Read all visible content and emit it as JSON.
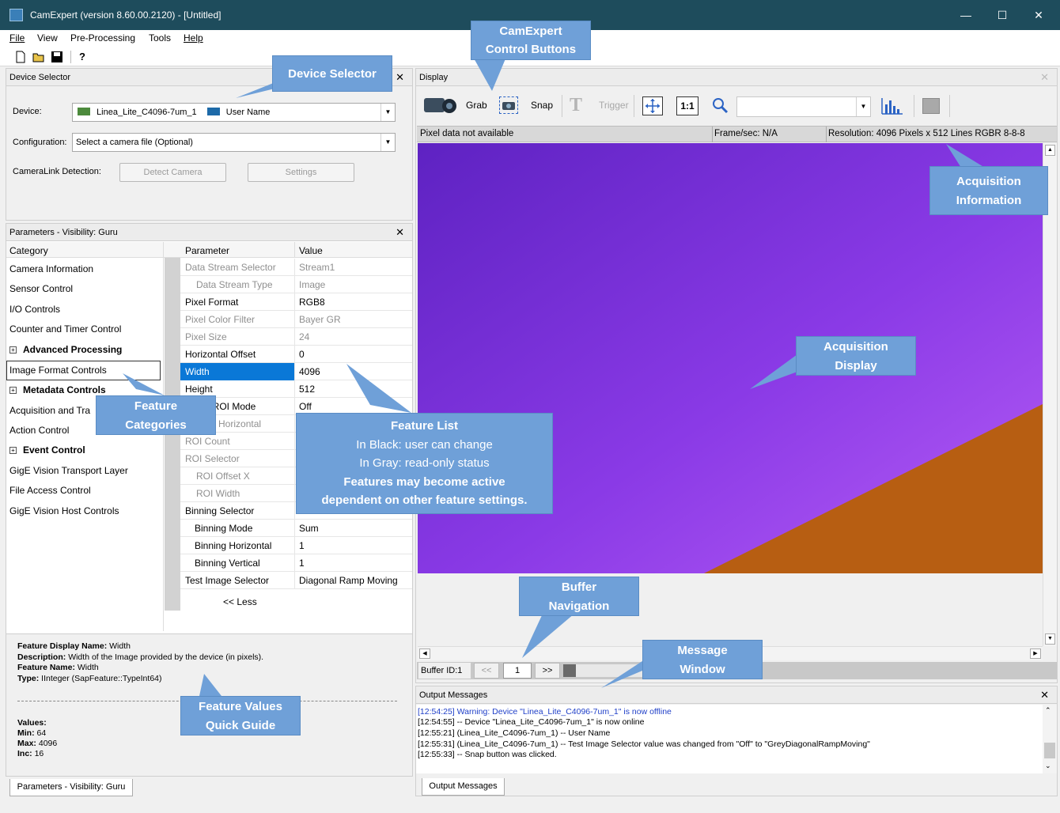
{
  "window": {
    "title": "CamExpert (version 8.60.00.2120) - [Untitled]",
    "controls": [
      "—",
      "☐",
      "✕"
    ]
  },
  "menu": [
    "File",
    "View",
    "Pre-Processing",
    "Tools",
    "Help"
  ],
  "toolbar_icons": [
    "new-file-icon",
    "open-folder-icon",
    "save-icon",
    "help-icon"
  ],
  "device_selector": {
    "title": "Device Selector",
    "device_label": "Device:",
    "device_value": "Linea_Lite_C4096-7um_1",
    "user_name": "User Name",
    "configuration_label": "Configuration:",
    "configuration_value": "Select a camera file (Optional)",
    "cameralink_label": "CameraLink Detection:",
    "detect_button": "Detect Camera",
    "settings_button": "Settings"
  },
  "parameters": {
    "title": "Parameters - Visibility: Guru",
    "category_header": "Category",
    "parameter_header": "Parameter",
    "value_header": "Value",
    "categories": [
      {
        "label": "Camera Information",
        "bold": false,
        "expandable": false
      },
      {
        "label": "Sensor Control",
        "bold": false,
        "expandable": false
      },
      {
        "label": "I/O Controls",
        "bold": false,
        "expandable": false
      },
      {
        "label": "Counter and Timer Control",
        "bold": false,
        "expandable": false
      },
      {
        "label": "Advanced Processing",
        "bold": true,
        "expandable": true
      },
      {
        "label": "Image Format Controls",
        "bold": false,
        "expandable": false,
        "selected": true
      },
      {
        "label": "Metadata Controls",
        "bold": true,
        "expandable": true
      },
      {
        "label": "Acquisition and Tra",
        "bold": false,
        "expandable": false
      },
      {
        "label": "Action Control",
        "bold": false,
        "expandable": false
      },
      {
        "label": "Event Control",
        "bold": true,
        "expandable": true
      },
      {
        "label": "GigE Vision Transport Layer",
        "bold": false,
        "expandable": false
      },
      {
        "label": "File Access Control",
        "bold": false,
        "expandable": false
      },
      {
        "label": "GigE Vision Host Controls",
        "bold": false,
        "expandable": false
      }
    ],
    "rows": [
      {
        "name": "Data Stream Selector",
        "value": "Stream1",
        "readonly": true
      },
      {
        "name": "  Data Stream Type",
        "value": "Image",
        "readonly": true
      },
      {
        "name": "Pixel Format",
        "value": "RGB8",
        "readonly": false
      },
      {
        "name": "Pixel Color Filter",
        "value": "Bayer GR",
        "readonly": true
      },
      {
        "name": "Pixel Size",
        "value": "24",
        "readonly": true
      },
      {
        "name": "Horizontal Offset",
        "value": "0",
        "readonly": false
      },
      {
        "name": "Width",
        "value": "4096",
        "readonly": false,
        "selected": true
      },
      {
        "name": "Height",
        "value": "512",
        "readonly": false
      },
      {
        "name": "le ROI Mode",
        "value": "Off",
        "readonly": false
      },
      {
        "name": "unt Horizontal",
        "value": "",
        "readonly": true
      },
      {
        "name": "ROI Count",
        "value": "",
        "readonly": true
      },
      {
        "name": "ROI Selector",
        "value": "",
        "readonly": true
      },
      {
        "name": "  ROI Offset X",
        "value": "",
        "readonly": true
      },
      {
        "name": "  ROI Width",
        "value": "",
        "readonly": true
      },
      {
        "name": "Binning Selector",
        "value": "",
        "readonly": false
      },
      {
        "name": "  Binning Mode",
        "value": "Sum",
        "readonly": false
      },
      {
        "name": "  Binning Horizontal",
        "value": "1",
        "readonly": false
      },
      {
        "name": "  Binning Vertical",
        "value": "1",
        "readonly": false
      },
      {
        "name": "Test Image Selector",
        "value": "Diagonal Ramp Moving",
        "readonly": false
      }
    ],
    "less_link": "<< Less",
    "bottom_tab": "Parameters - Visibility: Guru"
  },
  "feature_info": {
    "display_name_label": "Feature Display Name:",
    "display_name": "Width",
    "description_label": "Description:",
    "description": "Width of the Image provided by the device (in pixels).",
    "feature_name_label": "Feature Name:",
    "feature_name": "Width",
    "type_label": "Type:",
    "type": "IInteger (SapFeature::TypeInt64)",
    "values_label": "Values:",
    "min_label": "Min:",
    "min": "64",
    "max_label": "Max:",
    "max": "4096",
    "inc_label": "Inc:",
    "inc": "16"
  },
  "display": {
    "title": "Display",
    "grab": "Grab",
    "snap": "Snap",
    "trigger": "Trigger",
    "one_to_one": "1:1",
    "status_pixel": "Pixel data not available",
    "status_fps": "Frame/sec: N/A",
    "status_resolution": "Resolution: 4096 Pixels x 512 Lines  RGBR 8-8-8",
    "buffer_id": "Buffer ID:1",
    "buffer_prev": "<<",
    "buffer_value": "1",
    "buffer_next": ">>"
  },
  "output": {
    "title": "Output Messages",
    "tab": "Output Messages",
    "messages": [
      {
        "text": "[12:54:25] Warning: Device \"Linea_Lite_C4096-7um_1\" is now offline",
        "color": "#1f3fc8"
      },
      {
        "text": "[12:54:55] -- Device \"Linea_Lite_C4096-7um_1\" is now online",
        "color": "#000000"
      },
      {
        "text": "[12:55:21] (Linea_Lite_C4096-7um_1)  -- User Name",
        "color": "#000000"
      },
      {
        "text": "[12:55:31] (Linea_Lite_C4096-7um_1)  -- Test Image Selector value was changed from \"Off\" to \"GreyDiagonalRampMoving\"",
        "color": "#000000"
      },
      {
        "text": "[12:55:33] -- Snap button was clicked.",
        "color": "#000000"
      }
    ]
  },
  "callouts": {
    "control_buttons_line1": "CamExpert",
    "control_buttons_line2": "Control Buttons",
    "device_selector": "Device Selector",
    "acq_info_line1": "Acquisition",
    "acq_info_line2": "Information",
    "acq_display_line1": "Acquisition",
    "acq_display_line2": "Display",
    "feature_categories_line1": "Feature",
    "feature_categories_line2": "Categories",
    "feature_list_line1": "Feature List",
    "feature_list_line2": "In Black: user can change",
    "feature_list_line3": "In Gray: read-only status",
    "feature_list_line4": "Features may become active",
    "feature_list_line5": "dependent on other feature settings.",
    "buffer_nav_line1": "Buffer",
    "buffer_nav_line2": "Navigation",
    "message_window_line1": "Message",
    "message_window_line2": "Window",
    "quick_guide_line1": "Feature Values",
    "quick_guide_line2": "Quick Guide"
  },
  "colors": {
    "titlebar": "#1e4c5c",
    "callout": "#6fa0d8",
    "image_purple": "#7a2bd6",
    "image_orange": "#b75e12",
    "selection": "#0a78d7"
  }
}
